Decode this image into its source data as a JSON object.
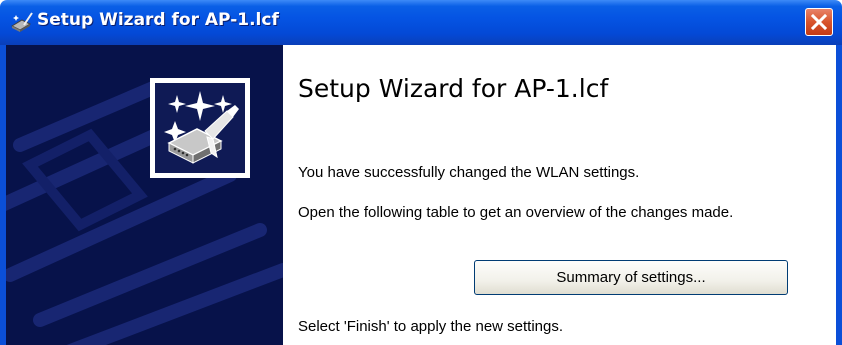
{
  "window": {
    "title": "Setup Wizard for AP-1.lcf",
    "title_icon": "wizard-app-icon",
    "close_icon": "close-icon",
    "colors": {
      "titlebar": "#0554e3",
      "close_button": "#d8542c",
      "side_panel": "#07124a"
    }
  },
  "side_panel": {
    "icon": "device-magic-wand-icon"
  },
  "content": {
    "heading": "Setup Wizard for AP-1.lcf",
    "success_message": "You have successfully changed the WLAN settings.",
    "overview_message": "Open the following table to get an overview of the changes made.",
    "summary_button_label": "Summary of settings...",
    "finish_instruction": "Select 'Finish' to apply the new settings."
  }
}
